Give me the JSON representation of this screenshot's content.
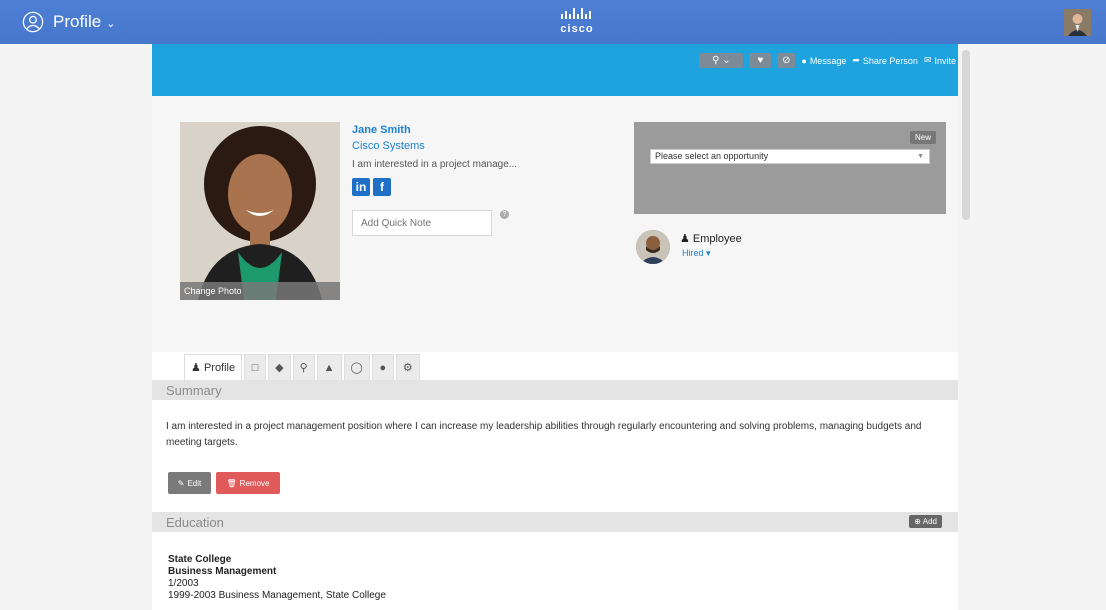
{
  "topbar": {
    "profile_label": "Profile",
    "logo_text": "cisco"
  },
  "actions": {
    "message": "Message",
    "share": "Share Person",
    "invite": "Invite"
  },
  "person": {
    "name": "Jane Smith",
    "company": "Cisco Systems",
    "headline": "I am interested in a project manage...",
    "photo_caption": "Change Photo",
    "quick_note_placeholder": "Add Quick Note"
  },
  "opportunity": {
    "badge": "New",
    "select_value": "Please select an opportunity"
  },
  "employee": {
    "label": "Employee",
    "status": "Hired"
  },
  "tabs": {
    "profile": "Profile"
  },
  "summary": {
    "title": "Summary",
    "text": "I am interested in a project management position where I can increase my leadership abilities through regularly encountering and solving problems, managing budgets and meeting targets.",
    "edit": "Edit",
    "remove": "Remove"
  },
  "education": {
    "title": "Education",
    "add": "Add",
    "school": "State College",
    "degree": "Business Management",
    "date": "1/2003",
    "detail": "1999-2003 Business Management, State College"
  },
  "colors": {
    "topbar": "#4a7bd0",
    "band": "#1ea3df",
    "link": "#1a7fd0",
    "remove": "#e05a5a"
  }
}
